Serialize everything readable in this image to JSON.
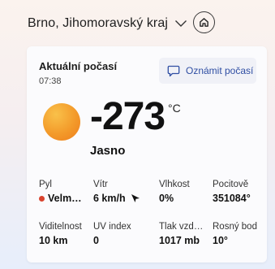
{
  "header": {
    "location": "Brno, Jihomoravský kraj",
    "chevron_icon": "chevron-down-icon",
    "home_icon": "home-icon"
  },
  "card": {
    "title": "Aktuální počasí",
    "time": "07:38",
    "report_button": {
      "label": "Oznámit počasí",
      "icon": "chat-bubble-icon"
    },
    "weather_icon": "sun-icon",
    "temperature": "-273",
    "unit": "°C",
    "condition": "Jasno",
    "details": [
      {
        "label": "Pyl",
        "value": "Velm…",
        "indicator_color": "#d9432e"
      },
      {
        "label": "Vítr",
        "value": "6 km/h",
        "icon": "wind-direction-arrow-icon"
      },
      {
        "label": "Vlhkost",
        "value": "0%"
      },
      {
        "label": "Pocitově",
        "value": "351084°"
      },
      {
        "label": "Viditelnost",
        "value": "10 km"
      },
      {
        "label": "UV index",
        "value": "0"
      },
      {
        "label": "Tlak vzd…",
        "value": "1017 mb"
      },
      {
        "label": "Rosný bod",
        "value": "10°"
      }
    ]
  }
}
